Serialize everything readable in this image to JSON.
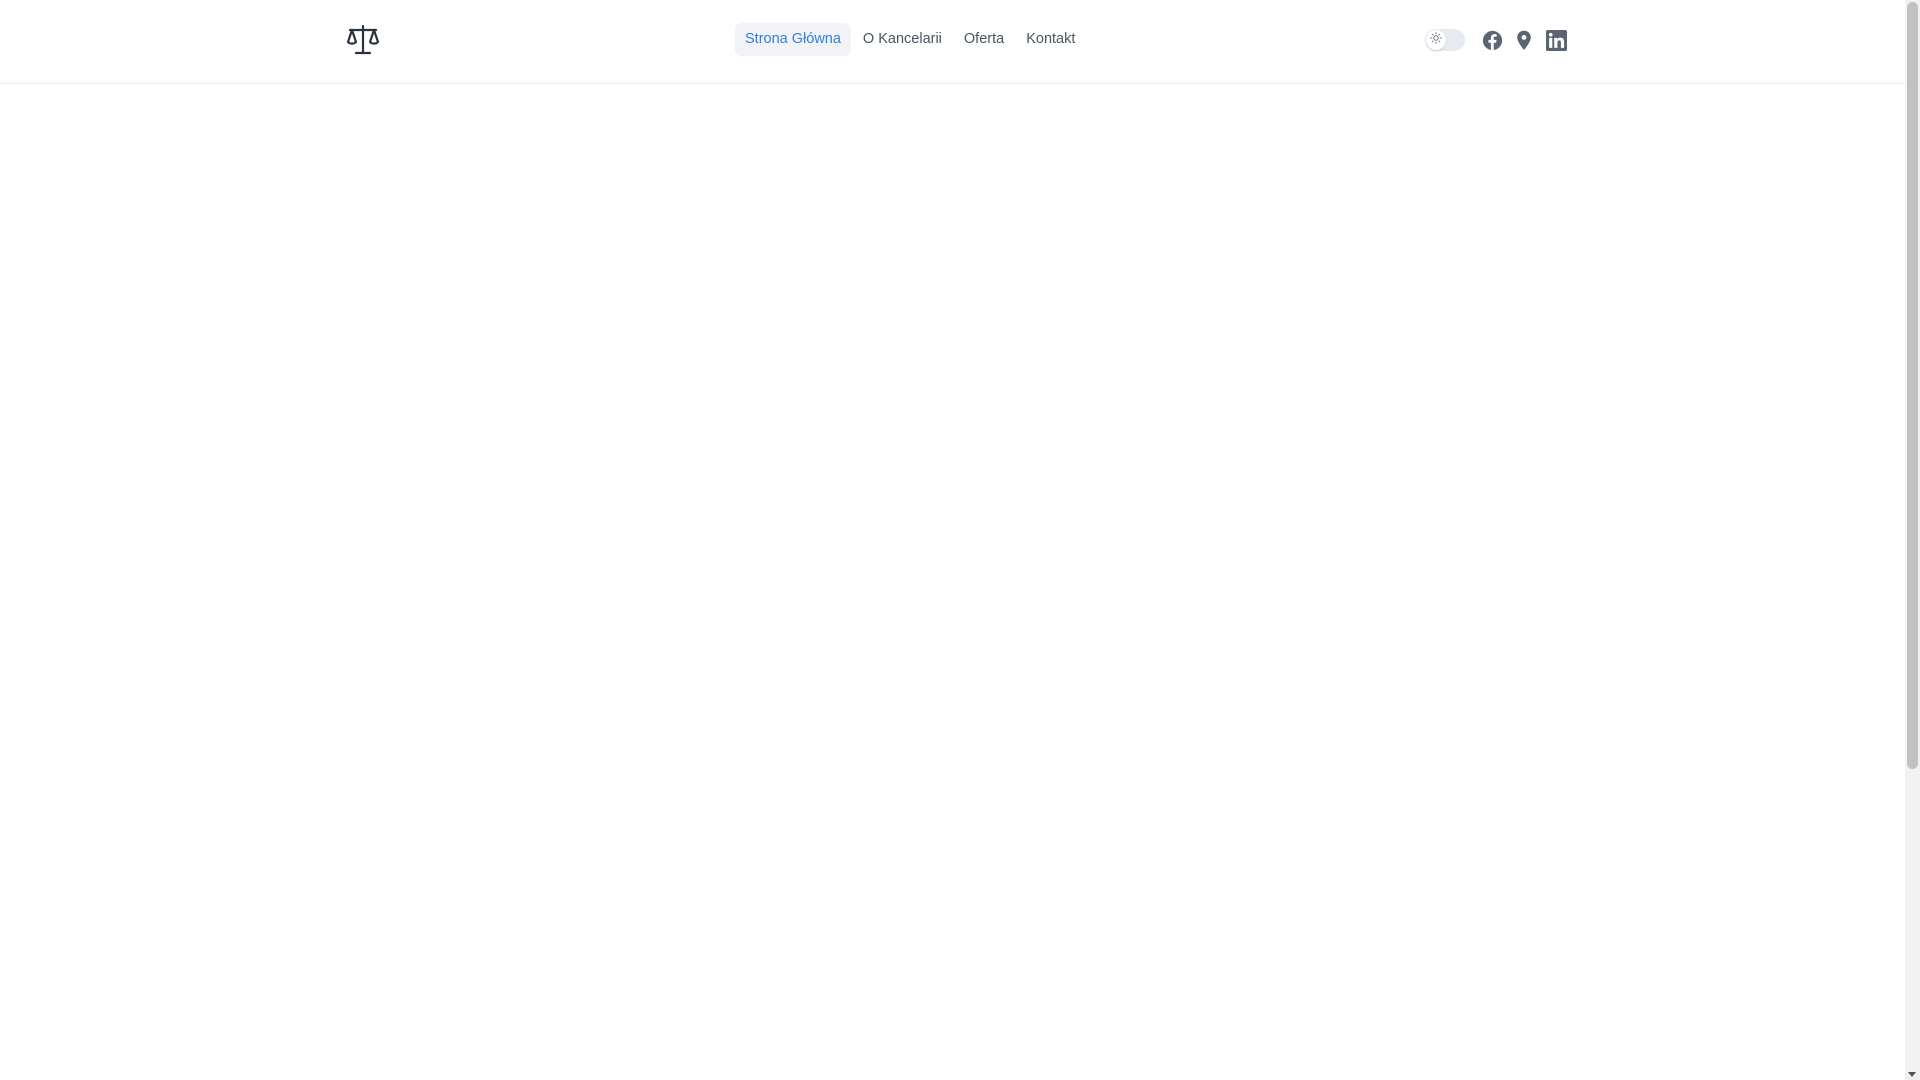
{
  "nav": {
    "items": [
      {
        "label": "Strona Główna",
        "active": true
      },
      {
        "label": "O Kancelarii",
        "active": false
      },
      {
        "label": "Oferta",
        "active": false
      },
      {
        "label": "Kontakt",
        "active": false
      }
    ]
  },
  "header": {
    "logo_icon": "scales-of-justice-icon",
    "theme_toggle": {
      "state": "light",
      "icon": "sun-icon"
    },
    "social_icons": [
      "facebook-icon",
      "map-pin-icon",
      "linkedin-icon"
    ]
  },
  "colors": {
    "accent": "#2f7fe0",
    "nav_text": "#4a5565",
    "icon": "#5b6472",
    "logo": "#2b3340"
  }
}
